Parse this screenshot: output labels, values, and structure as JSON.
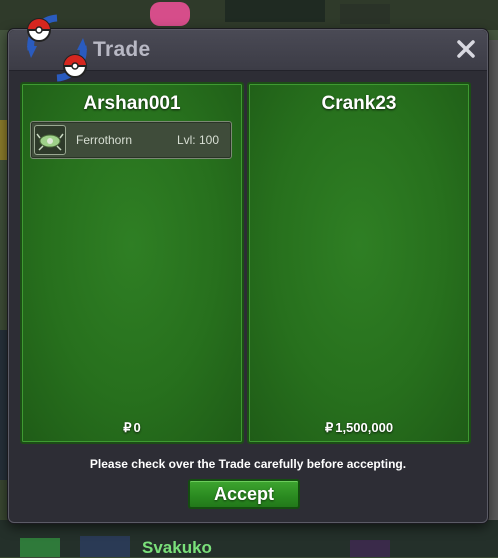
{
  "window": {
    "title": "Trade",
    "colors": {
      "panel_green": "#27701d",
      "panel_border": "#1c4d16",
      "window_bg": "#2d2d35",
      "accept_green": "#2a8a20"
    },
    "icons": {
      "logo": "trade-arrows-pokeball-icon",
      "close": "close-icon",
      "currency": "pokedollar-icon"
    }
  },
  "trade": {
    "currency_symbol": "₽",
    "left": {
      "player_name": "Arshan001",
      "money": "0",
      "items": [
        {
          "name": "Ferrothorn",
          "level": "Lvl: 100",
          "icon": "ferrothorn-sprite-icon"
        }
      ]
    },
    "right": {
      "player_name": "Crank23",
      "money": "1,500,000",
      "items": []
    }
  },
  "footer": {
    "notice": "Please check over the Trade carefully before accepting.",
    "accept_label": "Accept"
  },
  "background": {
    "visible_text": "Svakuko"
  }
}
